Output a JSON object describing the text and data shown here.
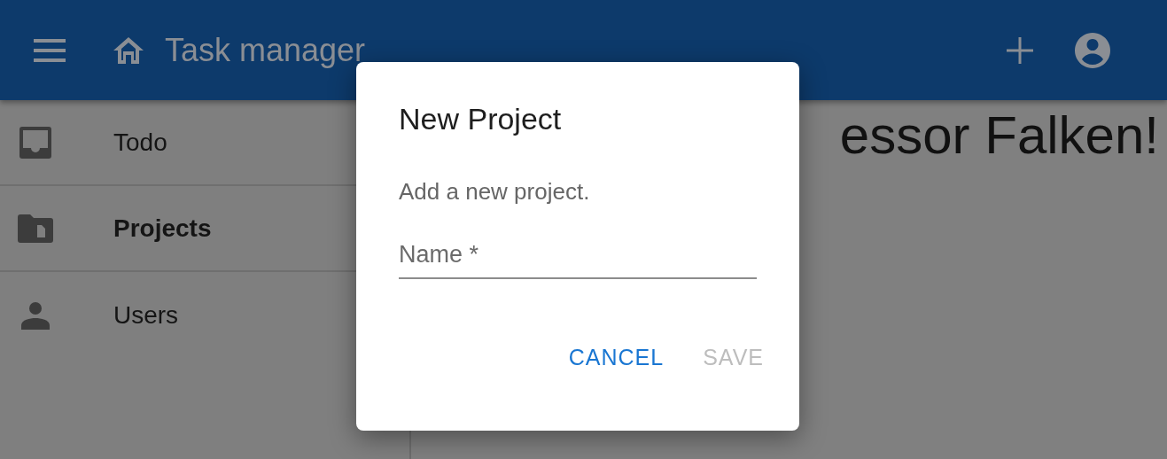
{
  "app_bar": {
    "title": "Task manager"
  },
  "sidebar": {
    "items": [
      {
        "label": "Todo",
        "selected": false
      },
      {
        "label": "Projects",
        "selected": true
      },
      {
        "label": "Users",
        "selected": false
      }
    ]
  },
  "main": {
    "heading": "essor Falken!"
  },
  "dialog": {
    "title": "New Project",
    "text": "Add a new project.",
    "field": {
      "placeholder": "Name *"
    },
    "buttons": [
      {
        "label": "CANCEL",
        "disabled": false
      },
      {
        "label": "SAVE",
        "disabled": true
      }
    ]
  }
}
